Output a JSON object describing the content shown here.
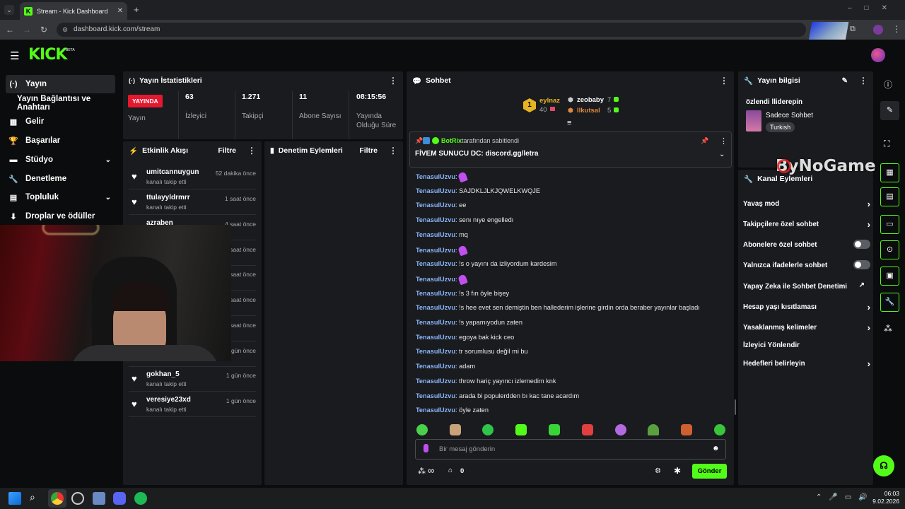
{
  "browser": {
    "tab_title": "Stream - Kick Dashboard",
    "favicon_letter": "K",
    "new_tab": "+",
    "url": "dashboard.kick.com/stream"
  },
  "kick": {
    "logo": "KICK",
    "beta": "BETA"
  },
  "sidebar": {
    "items": [
      {
        "label": "Yayın",
        "icon": "broadcast-icon",
        "glyph": "(·)",
        "active": true
      },
      {
        "label": "Yayın Bağlantısı ve Anahtarı",
        "icon": "",
        "glyph": ""
      },
      {
        "label": "Gelir",
        "icon": "revenue-icon",
        "glyph": "▦"
      },
      {
        "label": "Başarılar",
        "icon": "trophy-icon",
        "glyph": "🏆"
      },
      {
        "label": "Stüdyo",
        "icon": "studio-icon",
        "glyph": "▬",
        "chevron": "⌄"
      },
      {
        "label": "Denetleme",
        "icon": "wrench-icon",
        "glyph": "🔧"
      },
      {
        "label": "Topluluk",
        "icon": "community-icon",
        "glyph": "▤",
        "chevron": "⌄"
      },
      {
        "label": "Droplar ve ödüller",
        "icon": "drops-icon",
        "glyph": "⬇"
      }
    ]
  },
  "stats": {
    "title": "Yayın İstatistikleri",
    "live_badge": "YAYINDA",
    "live_label": "Yayın",
    "viewers": {
      "value": "63",
      "label": "İzleyici"
    },
    "followers": {
      "value": "1.271",
      "label": "Takipçi"
    },
    "subs": {
      "value": "11",
      "label": "Abone Sayısı"
    },
    "duration": {
      "value": "08:15:56",
      "label": "Yayında Olduğu Süre"
    }
  },
  "activity": {
    "title": "Etkinlik Akışı",
    "filter": "Filtre",
    "events": [
      {
        "name": "umitcannuygun",
        "action": "kanalı takip etti",
        "time": "52 dakika önce"
      },
      {
        "name": "ttulayyldrmrr",
        "action": "kanalı takip etti",
        "time": "1 saat önce"
      },
      {
        "name": "azraben",
        "action": "kanalı takip etti",
        "time": "4 saat önce"
      },
      {
        "name": "",
        "action": "",
        "time": "saat önce"
      },
      {
        "name": "",
        "action": "",
        "time": "saat önce"
      },
      {
        "name": "",
        "action": "",
        "time": "saat önce"
      },
      {
        "name": "",
        "action": "",
        "time": "saat önce"
      },
      {
        "name": "",
        "action": "",
        "time": "gün önce"
      },
      {
        "name": "gokhan_5",
        "action": "kanalı takip etti",
        "time": "1 gün önce"
      },
      {
        "name": "veresiye23xd",
        "action": "kanalı takip etti",
        "time": "1 gün önce"
      }
    ]
  },
  "moderation": {
    "title": "Denetim Eylemleri",
    "filter": "Filtre"
  },
  "chat": {
    "title": "Sohbet",
    "leaders": {
      "first": {
        "rank": "1",
        "name": "eylnaz",
        "count": "40"
      },
      "second": {
        "name": "zeobaby",
        "count": "7"
      },
      "third": {
        "name": "Ilkutsal",
        "count": "5"
      }
    },
    "pinned": {
      "by": "BotRix",
      "by_suffix": "tarafından sabitlendi",
      "text": "FİVEM SUNUCU DC: discord.gg/letra"
    },
    "messages": [
      {
        "user": "TenasulUzvu",
        "text": "",
        "emote": true
      },
      {
        "user": "TenasulUzvu",
        "text": "SAJDKLJLKJQWELKWQJE"
      },
      {
        "user": "TenasulUzvu",
        "text": "ee"
      },
      {
        "user": "TenasulUzvu",
        "text": "senı nıye engelledı"
      },
      {
        "user": "TenasulUzvu",
        "text": "mq"
      },
      {
        "user": "TenasulUzvu",
        "text": "",
        "emote": true
      },
      {
        "user": "TenasulUzvu",
        "text": "!s o yayını da izliyordum kardesim"
      },
      {
        "user": "TenasulUzvu",
        "text": "",
        "emote": true
      },
      {
        "user": "TenasulUzvu",
        "text": "!s 3 fın öyle bişey"
      },
      {
        "user": "TenasulUzvu",
        "text": "!s hee evet sen demiştin ben hallederim işlerine girdin orda beraber yayınlar başladı"
      },
      {
        "user": "TenasulUzvu",
        "text": "!s yapamıyodun zaten"
      },
      {
        "user": "TenasulUzvu",
        "text": "egoya bak kick ceo"
      },
      {
        "user": "TenasulUzvu",
        "text": "tr sorumlusu değil mi bu"
      },
      {
        "user": "TenasulUzvu",
        "text": "adam"
      },
      {
        "user": "TenasulUzvu",
        "text": "throw hariç yayıncı izlemedim knk"
      },
      {
        "user": "TenasulUzvu",
        "text": "arada bi populerdden bı kac tane acardım"
      },
      {
        "user": "TenasulUzvu",
        "text": "öyle zaten"
      }
    ],
    "input_placeholder": "Bir mesaj gönderin",
    "infinity": "∞",
    "points": "0",
    "send": "Gönder"
  },
  "stream_info": {
    "title": "Yayın bilgisi",
    "stream_title": "özlendi lliderepin",
    "category": "Sadece Sohbet",
    "language": "Turkish"
  },
  "channel_actions": {
    "title": "Kanal Eylemleri",
    "items": [
      {
        "label": "Yavaş mod",
        "control": "chevron"
      },
      {
        "label": "Takipçilere özel sohbet",
        "control": "chevron"
      },
      {
        "label": "Abonelere özel sohbet",
        "control": "toggle",
        "on": false
      },
      {
        "label": "Yalnızca ifadelerle sohbet",
        "control": "toggle",
        "on": false
      },
      {
        "label": "Yapay Zeka ile Sohbet Denetimi",
        "control": "external"
      },
      {
        "label": "Hesap yaşı kısıtlaması",
        "control": "chevron"
      },
      {
        "label": "Yasaklanmış kelimeler",
        "control": "chevron"
      },
      {
        "label": "İzleyici Yönlendir",
        "control": "none"
      },
      {
        "label": "Hedefleri belirleyin",
        "control": "chevron"
      }
    ]
  },
  "watermark": "ByNoGame",
  "taskbar": {
    "time": "06:03",
    "date": "9.02.2026"
  },
  "colors": {
    "accent": "#53fc18",
    "live": "#e3192f",
    "username": "#8ab4f8",
    "panel": "#191b1f"
  }
}
